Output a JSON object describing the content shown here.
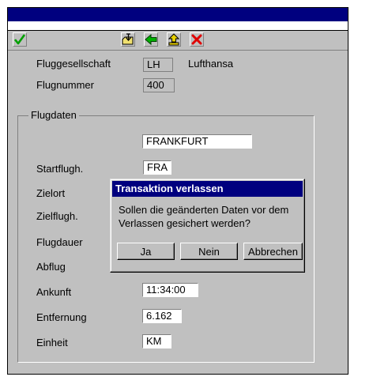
{
  "form": {
    "fields": [
      {
        "label": "Fluggesellschaft",
        "value": "LH",
        "extra": "Lufthansa"
      },
      {
        "label": "Flugnummer",
        "value": "400"
      }
    ],
    "group_title": "Flugdaten",
    "group_rows": [
      {
        "label": "",
        "value": "FRANKFURT"
      },
      {
        "label": "Startflugh.",
        "value": "FRA"
      },
      {
        "label": "Zielort",
        "value": ""
      },
      {
        "label": "Zielflugh.",
        "value": ""
      },
      {
        "label": "Flugdauer",
        "value": ""
      },
      {
        "label": "Abflug",
        "value": ""
      },
      {
        "label": "Ankunft",
        "value": "11:34:00"
      },
      {
        "label": "Entfernung",
        "value": "6.162"
      },
      {
        "label": "Einheit",
        "value": "KM"
      }
    ]
  },
  "dialog": {
    "title": "Transaktion verlassen",
    "message_line1": "Sollen die geänderten Daten vor dem",
    "message_line2": "Verlassen gesichert werden?",
    "buttons": {
      "yes": "Ja",
      "no": "Nein",
      "cancel": "Abbrechen"
    }
  },
  "toolbar": {
    "icons": [
      "checkmark-icon",
      "folder-exit-icon",
      "back-arrow-icon",
      "up-arrow-icon",
      "cancel-x-icon"
    ]
  },
  "colors": {
    "window_bg": "#c0c0c0",
    "title_blue": "#00007f",
    "check_green": "#00a000",
    "cancel_red": "#e00000",
    "arrow_green": "#00b000",
    "up_yellow": "#e8d000"
  }
}
